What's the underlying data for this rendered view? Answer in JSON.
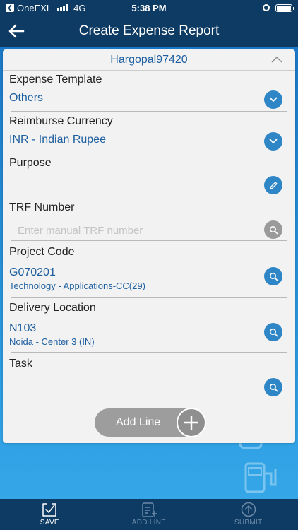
{
  "status_bar": {
    "carrier": "OneEXL",
    "network": "4G",
    "time": "5:38 PM"
  },
  "header": {
    "title": "Create Expense Report"
  },
  "card": {
    "title": "Hargopal97420"
  },
  "form": {
    "expense_template": {
      "label": "Expense Template",
      "value": "Others"
    },
    "reimburse_currency": {
      "label": "Reimburse Currency",
      "value": "INR - Indian Rupee"
    },
    "purpose": {
      "label": "Purpose",
      "value": ""
    },
    "trf_number": {
      "label": "TRF Number",
      "placeholder": "Enter manual TRF number",
      "value": ""
    },
    "project_code": {
      "label": "Project Code",
      "value": "G070201",
      "sub": "Technology - Applications-CC(29)"
    },
    "delivery_location": {
      "label": "Delivery Location",
      "value": "N103",
      "sub": "Noida - Center 3 (IN)"
    },
    "task": {
      "label": "Task",
      "value": ""
    }
  },
  "add_line_button": {
    "label": "Add Line"
  },
  "toolbar": {
    "save": "SAVE",
    "add_line": "ADD LINE",
    "submit": "SUBMIT"
  },
  "colors": {
    "header_bg": "#0e3b63",
    "accent": "#2f86c6",
    "value_text": "#1e5fa0"
  }
}
